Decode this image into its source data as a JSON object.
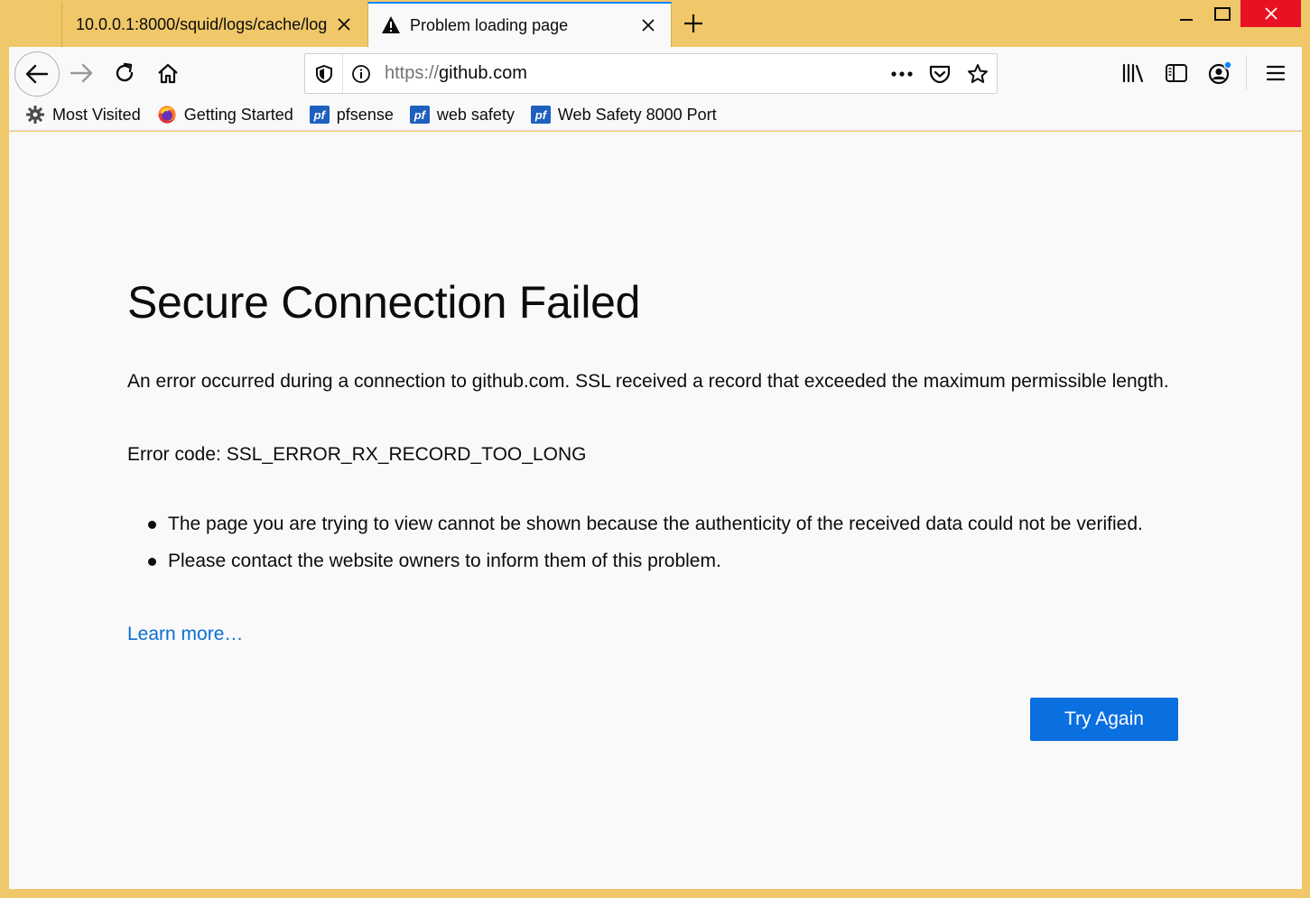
{
  "tabs": [
    {
      "title": "10.0.0.1:8000/squid/logs/cache/log",
      "active": false
    },
    {
      "title": "Problem loading page",
      "active": true
    }
  ],
  "navbar": {
    "url_scheme": "https://",
    "url_host": "github.com",
    "page_actions_label": "•••"
  },
  "bookmarks": [
    {
      "label": "Most Visited",
      "icon": "gear-icon"
    },
    {
      "label": "Getting Started",
      "icon": "firefox-icon"
    },
    {
      "label": "pfsense",
      "icon": "pfsense-icon"
    },
    {
      "label": "web safety",
      "icon": "pfsense-icon"
    },
    {
      "label": "Web Safety 8000 Port",
      "icon": "pfsense-icon"
    }
  ],
  "pf_icon_text": "pf",
  "error": {
    "title": "Secure Connection Failed",
    "description": "An error occurred during a connection to github.com. SSL received a record that exceeded the maximum permissible length.",
    "code_line": "Error code: SSL_ERROR_RX_RECORD_TOO_LONG",
    "bullets": [
      "The page you are trying to view cannot be shown because the authenticity of the received data could not be verified.",
      "Please contact the website owners to inform them of this problem."
    ],
    "learn_more": "Learn more…",
    "try_again": "Try Again"
  },
  "colors": {
    "frame": "#f0c869",
    "accent": "#0a84ff",
    "button": "#0a6fdf",
    "link": "#0a6fd6",
    "close": "#e81123"
  }
}
